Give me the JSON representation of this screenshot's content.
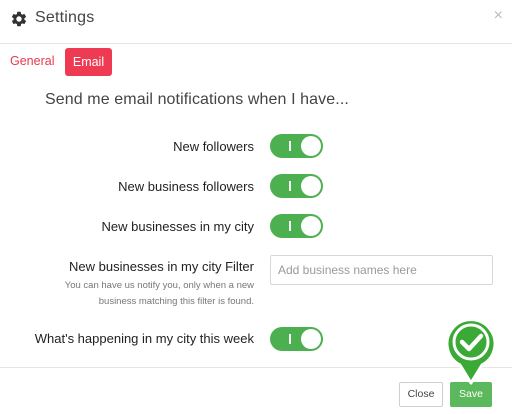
{
  "header": {
    "title": "Settings",
    "close_glyph": "×",
    "icon": "gear-icon"
  },
  "tabs": [
    {
      "label": "General",
      "active": false
    },
    {
      "label": "Email",
      "active": true
    }
  ],
  "section": {
    "heading": "Send me email notifications when I have..."
  },
  "settings": [
    {
      "label": "New followers",
      "enabled": true,
      "toggle_text": "I"
    },
    {
      "label": "New business followers",
      "enabled": true,
      "toggle_text": "I"
    },
    {
      "label": "New businesses in my city",
      "enabled": true,
      "toggle_text": "I"
    },
    {
      "label": "What's happening in my city this week",
      "enabled": true,
      "toggle_text": "I"
    }
  ],
  "filter": {
    "label": "New businesses in my city Filter",
    "help": "You can have us notify you, only when a new business matching this filter is found.",
    "placeholder": "Add business names here",
    "value": ""
  },
  "footer": {
    "close_label": "Close",
    "save_label": "Save"
  },
  "colors": {
    "accent_red": "#ee3a52",
    "toggle_green": "#4caf50",
    "save_green": "#5cb85c",
    "marker_green": "#3aa935"
  },
  "overlay": {
    "icon": "checkmark-marker-icon"
  }
}
